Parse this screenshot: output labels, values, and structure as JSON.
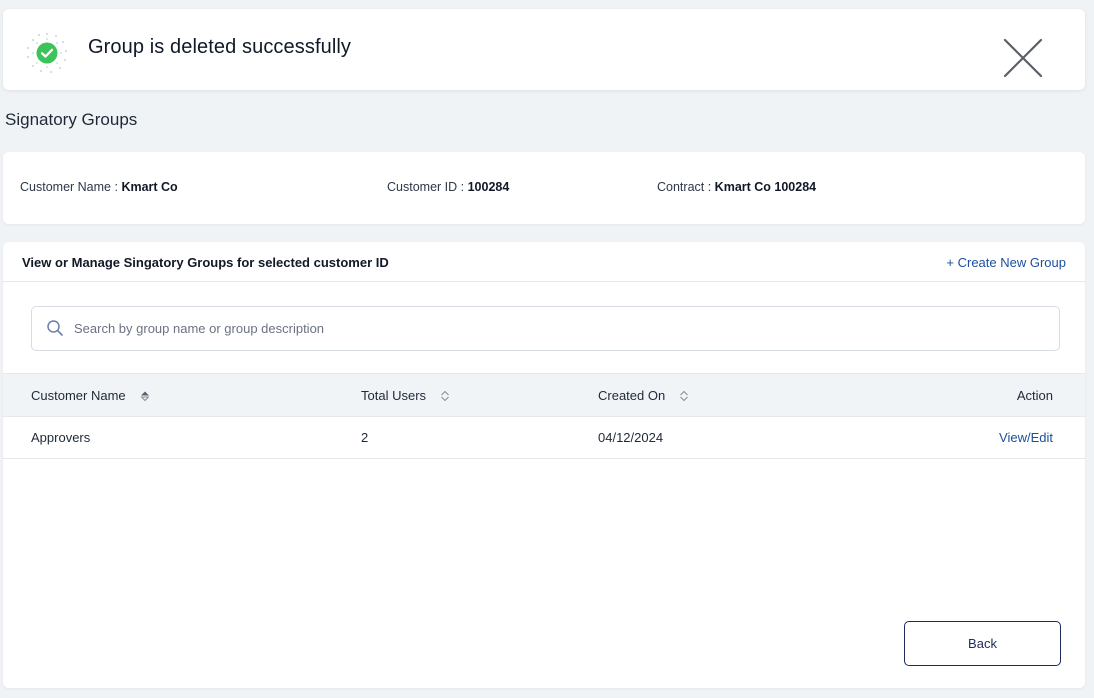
{
  "toast": {
    "message": "Group is deleted successfully",
    "icon": "success-check-icon",
    "accent": "#3cc45a"
  },
  "page": {
    "title": "Signatory Groups"
  },
  "customer_info": {
    "name_label": "Customer Name :",
    "name_value": "Kmart Co",
    "id_label": "Customer ID :",
    "id_value": "100284",
    "contract_label": "Contract :",
    "contract_value": "Kmart Co 100284"
  },
  "groups": {
    "heading": "View or Manage Singatory Groups for selected customer ID",
    "create_link": "+ Create New Group",
    "search_placeholder": "Search by group name or group description",
    "columns": {
      "name": "Customer Name",
      "users": "Total Users",
      "created": "Created On",
      "action": "Action"
    },
    "rows": [
      {
        "name": "Approvers",
        "users": "2",
        "created": "04/12/2024",
        "action": "View/Edit"
      }
    ],
    "back_label": "Back"
  },
  "colors": {
    "link": "#1d4f9c",
    "button_border": "#1f2a5a",
    "page_bg": "#f0f3f6"
  }
}
